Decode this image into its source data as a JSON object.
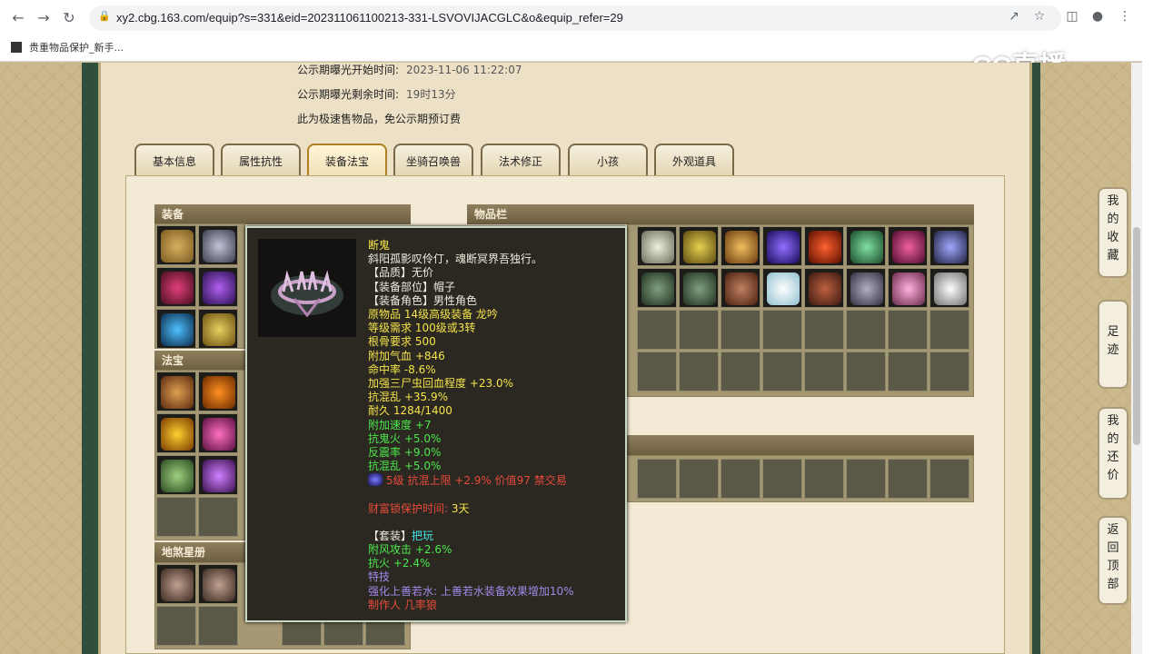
{
  "browser": {
    "url": "xy2.cbg.163.com/equip?s=331&eid=202311061100213-331-LSVOVIJACGLC&o&equip_refer=29",
    "bookmark": "贵重物品保护_新手..."
  },
  "watermark": "CC直播",
  "publicity": {
    "start_label": "公示期曝光开始时间:",
    "start_value": "2023-11-06 11:22:07",
    "remain_label": "公示期曝光剩余时间:",
    "remain_value": "19时13分",
    "note": "此为极速售物品，免公示期预订费"
  },
  "tabs": [
    "基本信息",
    "属性抗性",
    "装备法宝",
    "坐骑召唤兽",
    "法术修正",
    "小孩",
    "外观道具"
  ],
  "panels": {
    "equip": "装备",
    "treasure": "法宝",
    "earth": "地煞星册",
    "inventory": "物品栏"
  },
  "tooltip": {
    "name": "断鬼",
    "desc": "斜阳孤影叹伶仃，魂断冥界吾独行。",
    "quality": "【品质】无价",
    "slot": "【装备部位】帽子",
    "role": "【装备角色】男性角色",
    "origin": "原物品 14级高级装备 龙吟",
    "level_req": "等级需求 100级或3转",
    "bone_req": "根骨要求 500",
    "stat1": "附加气血 +846",
    "stat2": "命中率 -8.6%",
    "stat3": "加强三尸虫回血程度 +23.0%",
    "stat4": "抗混乱 +35.9%",
    "durability": "耐久 1284/1400",
    "stat5": "附加速度 +7",
    "stat6": "抗鬼火 +5.0%",
    "stat7": "反震率 +9.0%",
    "stat8": "抗混乱 +5.0%",
    "gem": "5级 抗混上限 +2.9% 价值97 禁交易",
    "protect_label": "财富锁保护时间:",
    "protect_value": "3天",
    "set_label": "【套装】",
    "set_name": "把玩",
    "set1": "附风攻击 +2.6%",
    "set2": "抗火 +2.4%",
    "skill_label": "特技",
    "skill": "强化上善若水: 上善若水装备效果增加10%",
    "maker": "制作人 几率狼"
  },
  "float_menu": {
    "fav": "我的收藏",
    "trace": "足迹",
    "bargain": "我的还价",
    "top": "返回顶部"
  },
  "colors": {
    "tooltip_bg": "#2a2820",
    "yellow": "#f6e44b",
    "green": "#4ee84e",
    "red": "#e84b3d",
    "purple": "#a388e8"
  }
}
